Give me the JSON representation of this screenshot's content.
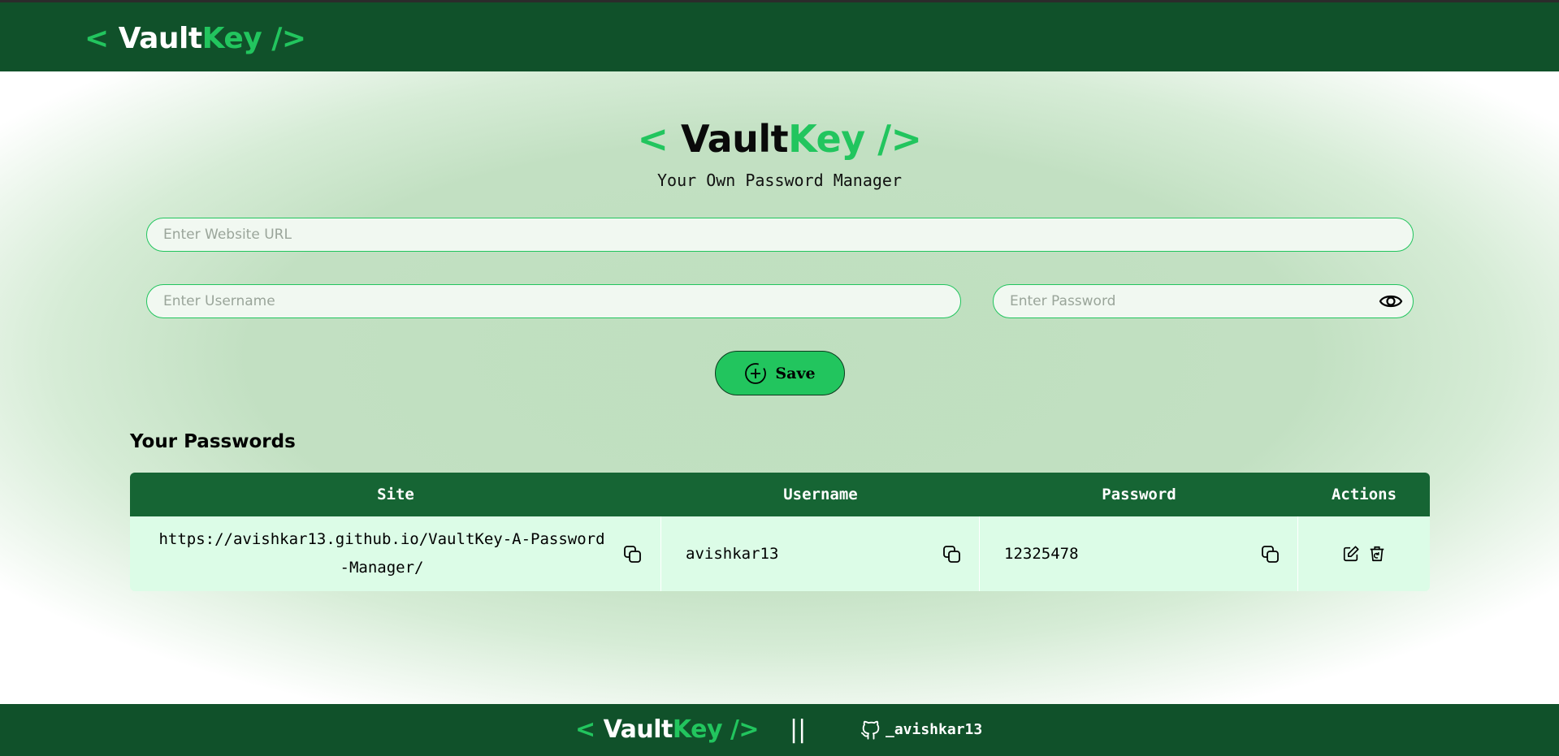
{
  "brand": {
    "open": "< ",
    "vault": "Vault",
    "key": "Key",
    "close": " />"
  },
  "colors": {
    "header_bg": "#10512a",
    "accent": "#22c55e",
    "table_header": "#166534",
    "row_bg": "#dcfce7"
  },
  "hero": {
    "tagline": "Your Own Password Manager"
  },
  "form": {
    "url_placeholder": "Enter Website URL",
    "username_placeholder": "Enter Username",
    "password_placeholder": "Enter Password",
    "save_label": "Save"
  },
  "passwords": {
    "title": "Your Passwords",
    "columns": [
      "Site",
      "Username",
      "Password",
      "Actions"
    ],
    "rows": [
      {
        "site": "https://avishkar13.github.io/VaultKey-A-Password-Manager/",
        "username": "avishkar13",
        "password": "12325478"
      }
    ]
  },
  "footer": {
    "separator": "||",
    "github_handle": "_avishkar13"
  },
  "icons": {
    "eye": "eye-icon",
    "save": "plus-circle-icon",
    "copy": "copy-icon",
    "edit": "edit-icon",
    "delete": "trash-icon",
    "github": "github-icon"
  }
}
